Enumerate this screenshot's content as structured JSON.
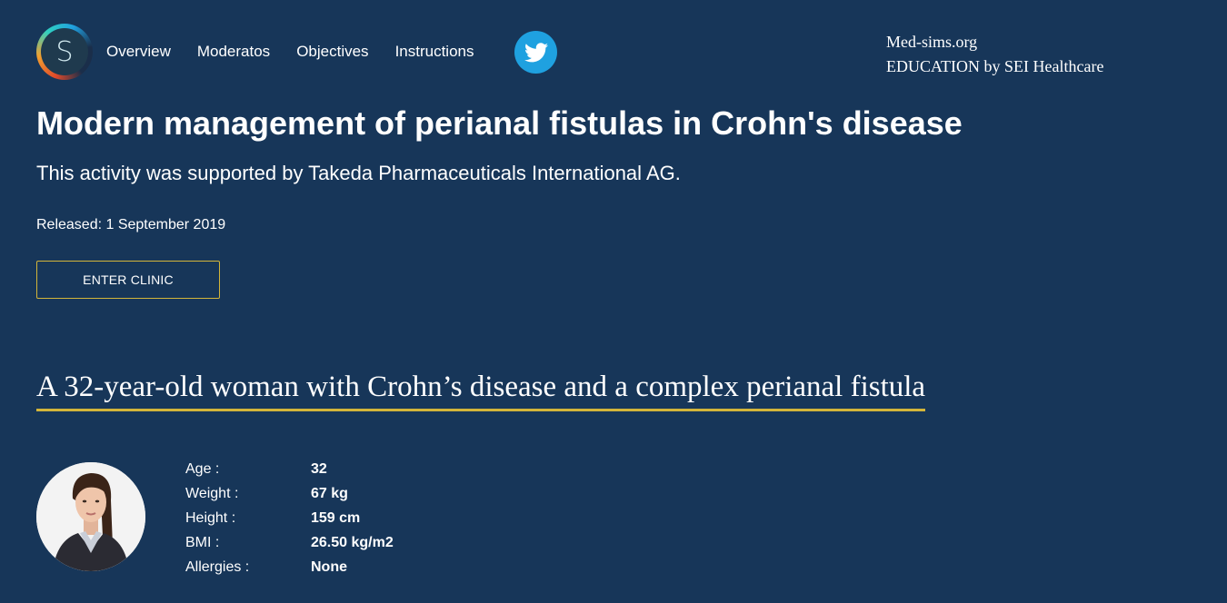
{
  "header": {
    "logo_letter": "S",
    "nav": [
      "Overview",
      "Moderatos",
      "Objectives",
      "Instructions"
    ],
    "brand_line1": "Med-sims.org",
    "brand_line2": "EDUCATION by SEI Healthcare"
  },
  "hero": {
    "title": "Modern management of perianal fistulas in Crohn's disease",
    "support": "This activity was supported by Takeda Pharmaceuticals International AG.",
    "released": "Released: 1 September 2019",
    "enter_button": "ENTER CLINIC"
  },
  "case": {
    "title": "A 32-year-old woman with Crohn’s disease and a complex perianal fistula",
    "stats": [
      {
        "label": "Age :",
        "value": "32"
      },
      {
        "label": "Weight :",
        "value": "67 kg"
      },
      {
        "label": "Height :",
        "value": "159 cm"
      },
      {
        "label": "BMI :",
        "value": "26.50 kg/m2"
      },
      {
        "label": "Allergies :",
        "value": "None"
      }
    ]
  },
  "colors": {
    "background": "#173659",
    "accent": "#d3b53a",
    "twitter": "#1fa1e0"
  },
  "icons": {
    "logo": "med-sims-logo-icon",
    "social": "twitter-bird-icon"
  }
}
